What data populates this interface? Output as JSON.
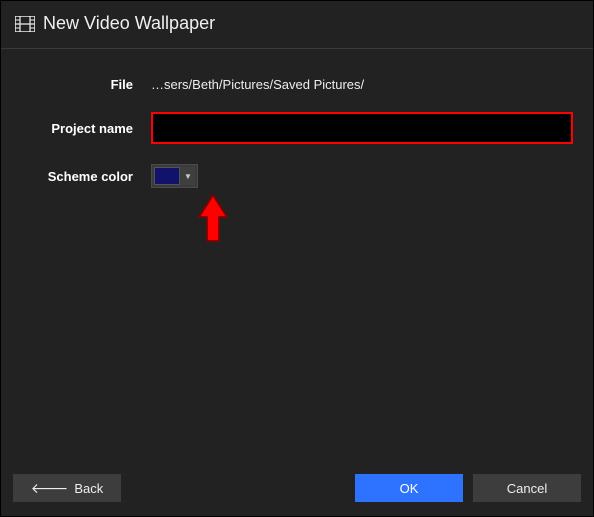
{
  "header": {
    "title": "New Video Wallpaper"
  },
  "form": {
    "file_label": "File",
    "file_value": "…sers/Beth/Pictures/Saved Pictures/",
    "project_name_label": "Project name",
    "project_name_value": "",
    "scheme_color_label": "Scheme color",
    "scheme_color_value": "#12126b"
  },
  "footer": {
    "back_label": "Back",
    "ok_label": "OK",
    "cancel_label": "Cancel"
  }
}
